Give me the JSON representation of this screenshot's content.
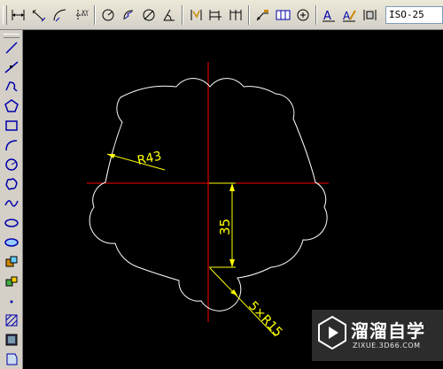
{
  "toolbar": {
    "buttons": [
      "linear-dimension-icon",
      "aligned-dimension-icon",
      "arc-length-icon",
      "ordinate-dimension-icon",
      "radius-dimension-icon",
      "jogged-dimension-icon",
      "diameter-dimension-icon",
      "angular-dimension-icon",
      "quick-dimension-icon",
      "baseline-dimension-icon",
      "continue-dimension-icon",
      "quick-leader-icon",
      "tolerance-icon",
      "center-mark-icon",
      "dimension-edit-icon",
      "dimension-text-edit-icon",
      "dimension-update-icon"
    ],
    "dim_style": "ISO-25"
  },
  "draw_toolbar": {
    "tools": [
      "line-icon",
      "construction-line-icon",
      "polyline-icon",
      "polygon-icon",
      "rectangle-icon",
      "arc-icon",
      "circle-icon",
      "revision-cloud-icon",
      "spline-icon",
      "ellipse-icon",
      "ellipse-arc-icon",
      "insert-block-icon",
      "make-block-icon",
      "point-icon",
      "hatch-icon",
      "gradient-icon",
      "region-icon"
    ]
  },
  "drawing": {
    "dim_r43": "R43",
    "dim_35": "35",
    "dim_5r15": "5×R15",
    "colors": {
      "background": "#000000",
      "outline": "#ffffff",
      "centerline": "#ff0000",
      "dimension": "#ffff00"
    }
  },
  "watermark": {
    "title": "溜溜自学",
    "url": "ZIXUE.3D66.COM"
  }
}
